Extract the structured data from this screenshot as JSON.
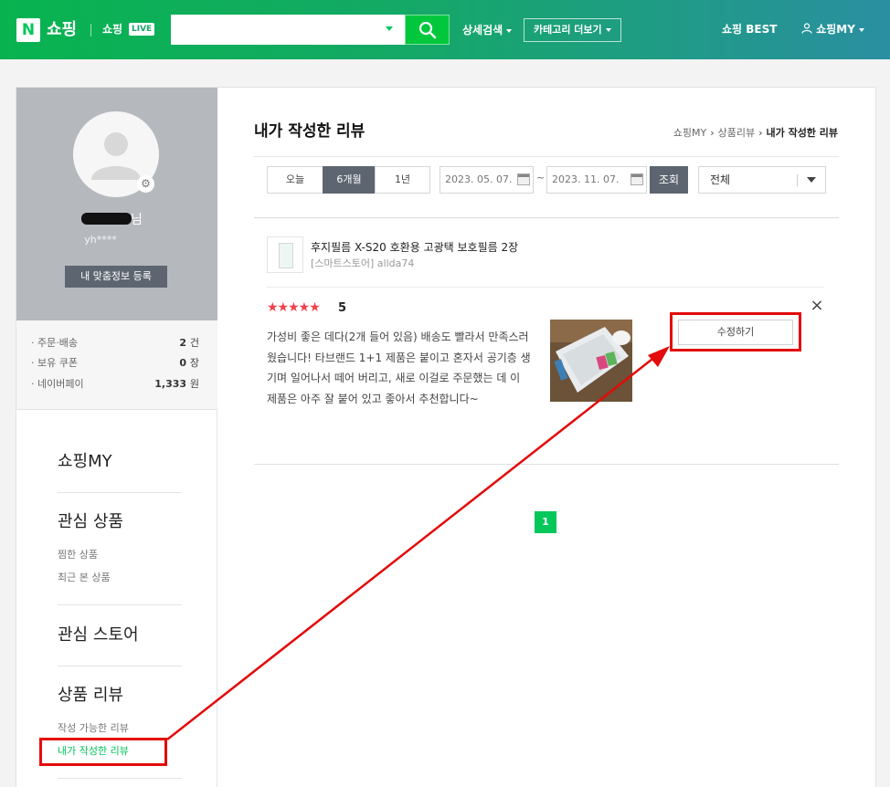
{
  "header": {
    "logo_letter": "N",
    "logo_text": "쇼핑",
    "live_text": "쇼핑",
    "live_badge": "LIVE",
    "search_placeholder": "",
    "detail_search": "상세검색",
    "category_more": "카테고리 더보기",
    "best": "쇼핑 BEST",
    "my": "쇼핑MY"
  },
  "profile": {
    "name_suffix": "님",
    "user_id": "yh****",
    "register_button": "내 맞춤정보 등록"
  },
  "stats": [
    {
      "label": "· 주문·배송",
      "value": "2",
      "unit": "건"
    },
    {
      "label": "· 보유 쿠폰",
      "value": "0",
      "unit": "장"
    },
    {
      "label": "· 네이버페이",
      "value": "1,333",
      "unit": "원"
    }
  ],
  "sidebar_menu": {
    "shopping_my": "쇼핑MY",
    "interest_products": "관심 상품",
    "liked_products": "찜한 상품",
    "recent_products": "최근 본 상품",
    "interest_stores": "관심 스토어",
    "product_reviews": "상품 리뷰",
    "writable_reviews": "작성 가능한 리뷰",
    "my_reviews": "내가 작성한 리뷰"
  },
  "page": {
    "title": "내가 작성한 리뷰",
    "breadcrumb": [
      "쇼핑MY",
      "상품리뷰",
      "내가 작성한 리뷰"
    ]
  },
  "filter": {
    "periods": [
      "오늘",
      "6개월",
      "1년"
    ],
    "selected_period": "6개월",
    "date_from": "2023. 05. 07.",
    "date_to": "2023. 11. 07.",
    "tilde": "~",
    "search_button": "조회",
    "select_value": "전체"
  },
  "review": {
    "product_name": "후지필름 X-S20 호환용 고광택 보호필름 2장",
    "store": "[스마트스토어] allda74",
    "stars": "★★★★★",
    "score": "5",
    "text": "가성비 좋은 데다(2개 들어 있음) 배송도 빨라서 만족스러웠습니다! 타브랜드 1+1 제품은 붙이고 혼자서 공기층 생기며 일어나서 떼어 버리고, 새로 이걸로 주문했는 데 이 제품은 아주 잘 붙어 있고 좋아서 추천합니다~",
    "edit_button": "수정하기",
    "close": "×"
  },
  "pagination": {
    "current": "1"
  },
  "colors": {
    "naver_green": "#03c75a",
    "annotation_red": "#e30b0b",
    "star_red": "#f0424b"
  }
}
